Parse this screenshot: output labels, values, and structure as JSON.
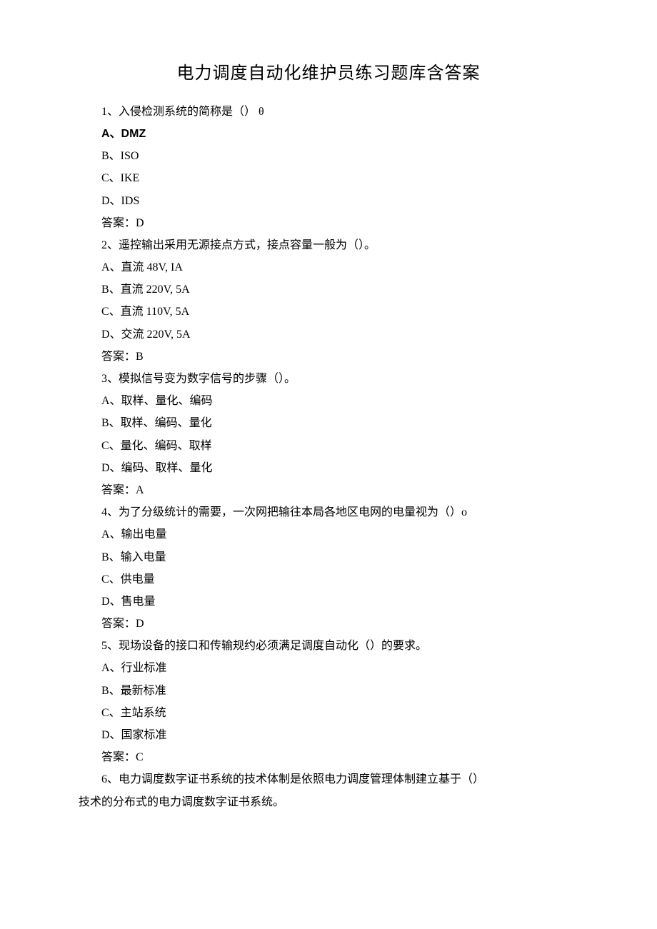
{
  "title": "电力调度自动化维护员练习题库含答案",
  "content": [
    {
      "cls": "line",
      "text": "1、入侵检测系统的简称是（） θ"
    },
    {
      "cls": "line sans",
      "text": "A、DMZ"
    },
    {
      "cls": "line",
      "text": "B、ISO"
    },
    {
      "cls": "line",
      "text": "C、IKE"
    },
    {
      "cls": "line",
      "text": "D、IDS"
    },
    {
      "cls": "line",
      "text": "答案：D"
    },
    {
      "cls": "line",
      "text": "2、遥控输出采用无源接点方式，接点容量一般为（）。"
    },
    {
      "cls": "line",
      "text": "A、直流 48V, IA"
    },
    {
      "cls": "line",
      "text": "B、直流 220V, 5A"
    },
    {
      "cls": "line",
      "text": "C、直流 110V, 5A"
    },
    {
      "cls": "line",
      "text": "D、交流 220V, 5A"
    },
    {
      "cls": "line",
      "text": "答案：B"
    },
    {
      "cls": "line",
      "text": "3、模拟信号变为数字信号的步骤（）。"
    },
    {
      "cls": "line",
      "text": "A、取样、量化、编码"
    },
    {
      "cls": "line",
      "text": "B、取样、编码、量化"
    },
    {
      "cls": "line",
      "text": "C、量化、编码、取样"
    },
    {
      "cls": "line",
      "text": "D、编码、取样、量化"
    },
    {
      "cls": "line",
      "text": "答案：A"
    },
    {
      "cls": "line",
      "text": "4、为了分级统计的需要，一次网把输往本局各地区电网的电量视为（）o"
    },
    {
      "cls": "line",
      "text": "A、输出电量"
    },
    {
      "cls": "line",
      "text": "B、输入电量"
    },
    {
      "cls": "line",
      "text": "C、供电量"
    },
    {
      "cls": "line",
      "text": "D、售电量"
    },
    {
      "cls": "line",
      "text": "答案：D"
    },
    {
      "cls": "line",
      "text": "5、现场设备的接口和传输规约必须满足调度自动化（）的要求。"
    },
    {
      "cls": "line",
      "text": "A、行业标准"
    },
    {
      "cls": "line",
      "text": "B、最新标准"
    },
    {
      "cls": "line",
      "text": "C、主站系统"
    },
    {
      "cls": "line",
      "text": "D、国家标准"
    },
    {
      "cls": "line",
      "text": "答案：C"
    },
    {
      "cls": "line",
      "text": "6、电力调度数字证书系统的技术体制是依照电力调度管理体制建立基于（）"
    },
    {
      "cls": "no-indent",
      "text": "技术的分布式的电力调度数字证书系统。"
    }
  ]
}
